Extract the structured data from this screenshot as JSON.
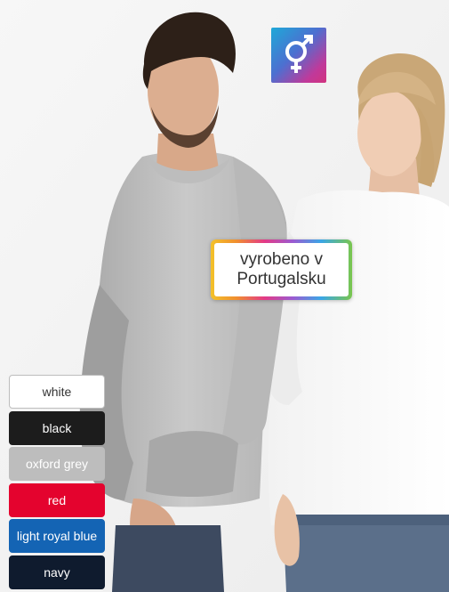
{
  "label": {
    "line1": "vyrobeno v",
    "line2": "Portugalsku"
  },
  "badge": {
    "icon": "gender-unisex-icon",
    "colors": [
      "#1ea8d8",
      "#c0399a"
    ]
  },
  "colors": [
    {
      "label": "white",
      "bg": "#ffffff",
      "fg": "#333333",
      "border": "#bdbdbd"
    },
    {
      "label": "black",
      "bg": "#1c1c1c",
      "fg": "#ffffff",
      "border": "#1c1c1c"
    },
    {
      "label": "oxford grey",
      "bg": "#bdbdbd",
      "fg": "#ffffff",
      "border": "#bdbdbd"
    },
    {
      "label": "red",
      "bg": "#e4032e",
      "fg": "#ffffff",
      "border": "#e4032e"
    },
    {
      "label": "light royal blue",
      "bg": "#1464b4",
      "fg": "#ffffff",
      "border": "#1464b4"
    },
    {
      "label": "navy",
      "bg": "#0f1b2e",
      "fg": "#ffffff",
      "border": "#0f1b2e"
    }
  ]
}
